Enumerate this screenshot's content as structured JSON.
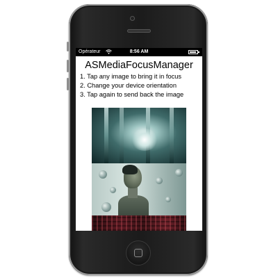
{
  "status_bar": {
    "carrier": "Opérateur",
    "wifi_icon": "wifi-icon",
    "time": "8:56 AM",
    "battery_icon": "battery-icon"
  },
  "app": {
    "title": "ASMediaFocusManager",
    "steps": [
      "1. Tap any image to bring it in focus",
      "2. Change your device orientation",
      "3. Tap again to send back the image"
    ]
  },
  "images": [
    {
      "name": "water-splash-image"
    },
    {
      "name": "portrait-image"
    },
    {
      "name": "red-pattern-image"
    }
  ],
  "colors": {
    "device_body": "#1b1b1b",
    "status_bar": "#000000",
    "screen_bg": "#ffffff"
  }
}
